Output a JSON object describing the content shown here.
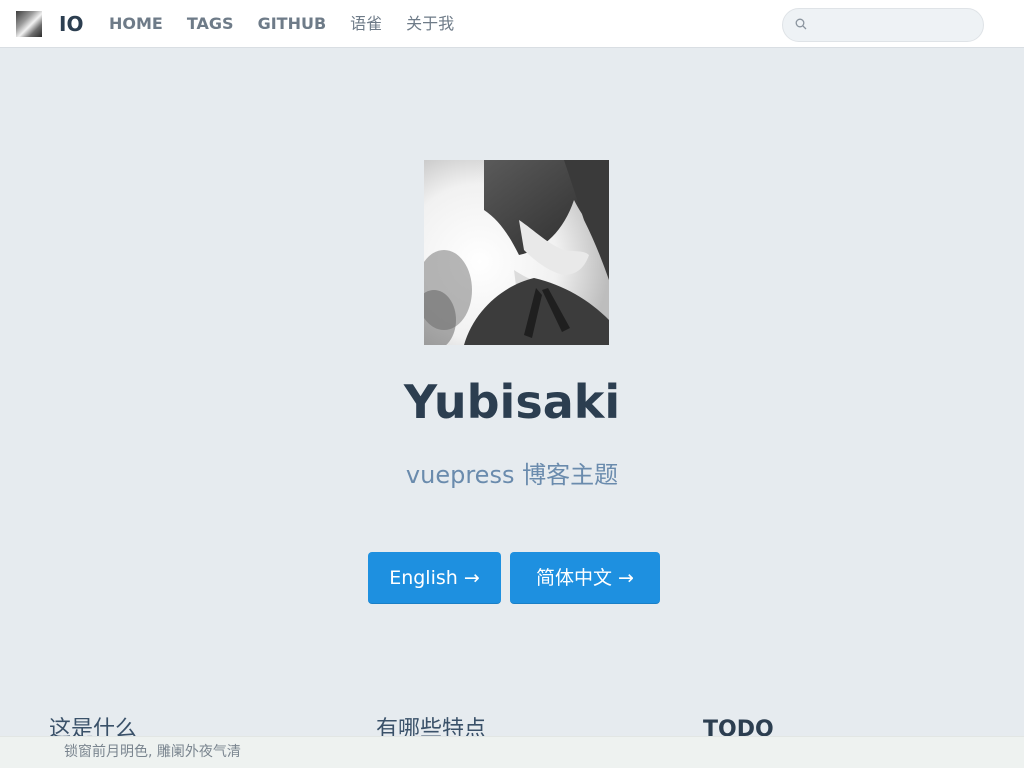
{
  "navbar": {
    "site_name": "IO",
    "links": [
      {
        "label": "HOME"
      },
      {
        "label": "TAGS"
      },
      {
        "label": "GITHUB"
      },
      {
        "label": "语雀"
      },
      {
        "label": "关于我"
      }
    ],
    "search": {
      "placeholder": "",
      "value": ""
    }
  },
  "hero": {
    "title": "Yubisaki",
    "description": "vuepress 博客主题",
    "buttons": [
      {
        "label": "English →"
      },
      {
        "label": "简体中文 →"
      }
    ]
  },
  "features": [
    {
      "title": "这是什么"
    },
    {
      "title": "有哪些特点"
    },
    {
      "title": "TODO"
    }
  ],
  "footer": {
    "text": "锁窗前月明色, 雕阑外夜气清"
  },
  "colors": {
    "accent": "#1e90e0",
    "background": "#e6ebef",
    "text": "#2c3e50",
    "subtitle": "#6a8bad"
  }
}
